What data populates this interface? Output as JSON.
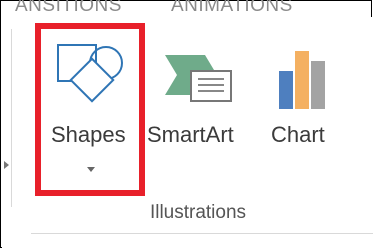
{
  "ribbon": {
    "tabs": [
      "ANSITIONS",
      "ANIMATIONS"
    ],
    "group_label": "Illustrations",
    "buttons": {
      "shapes": "Shapes",
      "smartart": "SmartArt",
      "chart": "Chart"
    }
  },
  "colors": {
    "highlight": "#e8202a",
    "icon_blue": "#2f75b5",
    "chart_blue": "#4e7fbf",
    "chart_orange": "#f4b061",
    "chart_gray": "#a3a3a3",
    "smartart_green": "#6fab8a"
  },
  "icons": [
    "shapes-icon",
    "smartart-icon",
    "chart-icon",
    "dropdown-arrow-icon",
    "scroll-left-icon"
  ]
}
